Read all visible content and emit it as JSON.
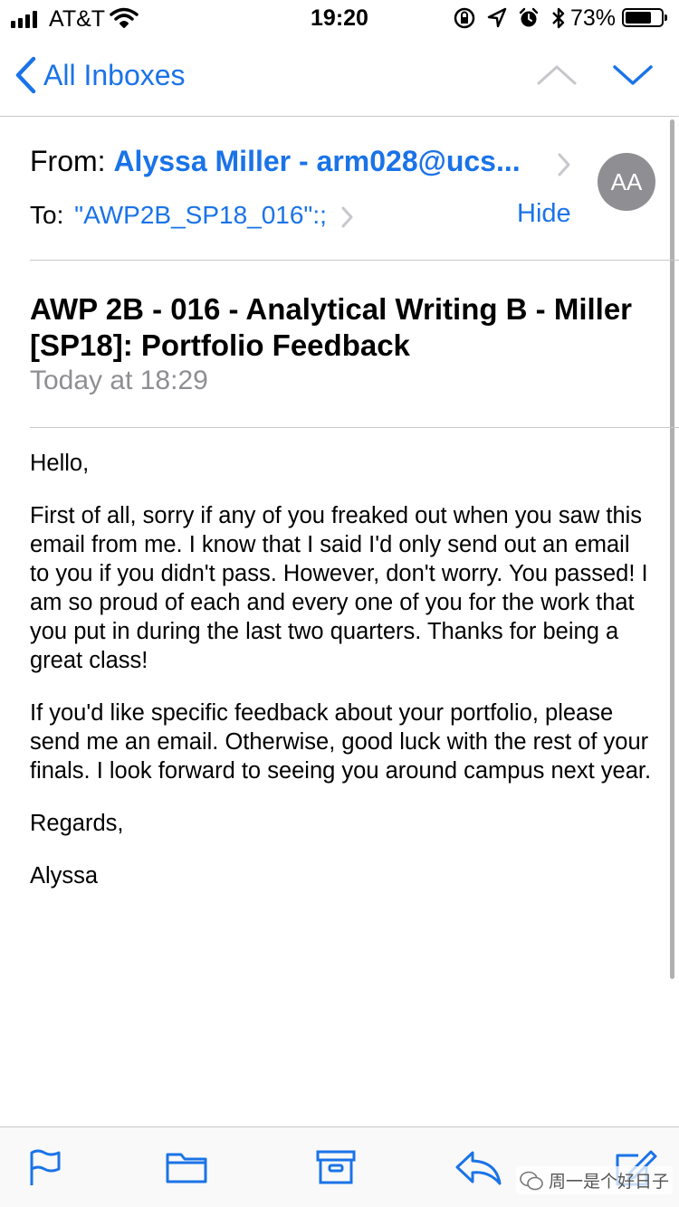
{
  "status_bar": {
    "carrier": "AT&T",
    "time": "19:20",
    "battery_percent": "73%",
    "battery_level": 0.73
  },
  "nav": {
    "back_label": "All Inboxes"
  },
  "message": {
    "from_label": "From:",
    "from_value": "Alyssa Miller - arm028@ucs...",
    "avatar_initials": "AA",
    "to_label": "To:",
    "to_value": "\"AWP2B_SP18_016\":;",
    "hide_label": "Hide",
    "subject": "AWP 2B - 016 - Analytical Writing B - Miller [SP18]: Portfolio Feedback",
    "date": "Today at 18:29",
    "body": [
      "Hello,",
      "First of all, sorry if any of you freaked out when you saw this email from me. I know that I said I'd only send out an email to you if you didn't pass. However, don't worry. You passed! I am so proud of each and every one of you for the work that you put in during the last two quarters. Thanks for being a great class!",
      "If you'd like specific feedback about your portfolio, please send me an email. Otherwise, good luck with the rest of your finals. I look forward to seeing you around campus next year.",
      "Regards,",
      "Alyssa"
    ]
  },
  "watermark": {
    "text": "周一是个好日子"
  },
  "colors": {
    "accent": "#1a73e8",
    "secondary_text": "#8e8e93",
    "separator": "#c8c7cc"
  },
  "icons": {
    "toolbar": [
      "flag-icon",
      "folder-icon",
      "archive-icon",
      "reply-icon",
      "compose-icon"
    ]
  }
}
